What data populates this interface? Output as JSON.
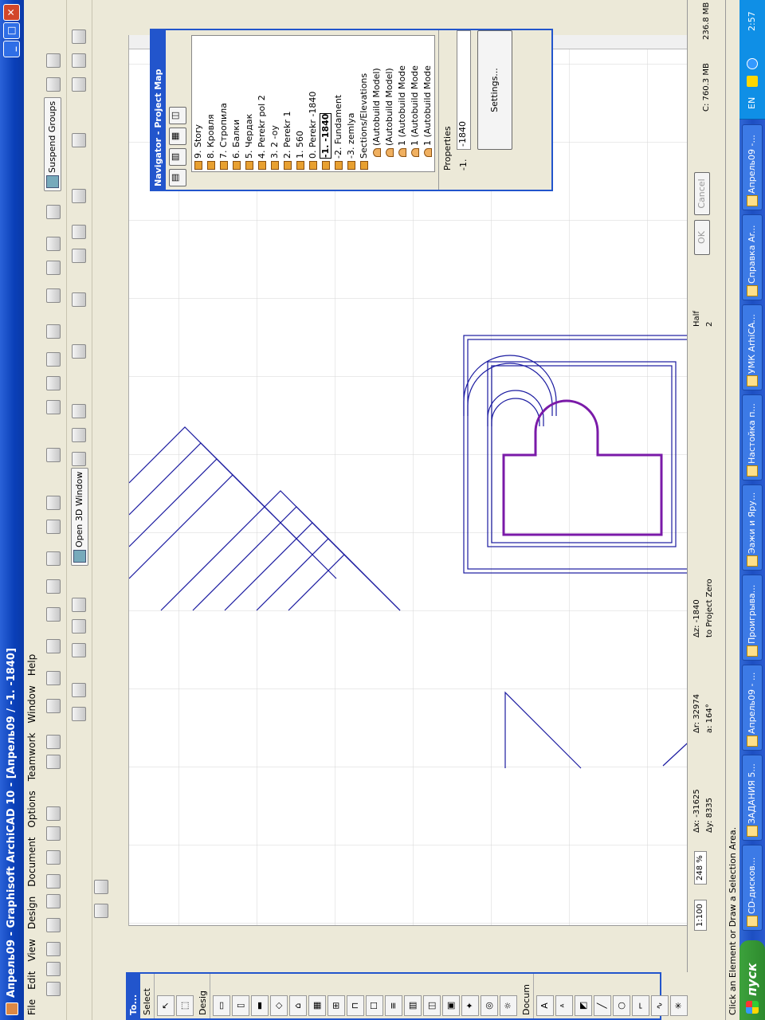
{
  "window": {
    "title": "Апрель09 - Graphisoft ArchiCAD 10 - [Апрель09 / -1. -1840]"
  },
  "menu": [
    "File",
    "Edit",
    "View",
    "Design",
    "Document",
    "Options",
    "Teamwork",
    "Window",
    "Help"
  ],
  "toolbar": {
    "suspend_groups": "Suspend Groups",
    "open_3d": "Open 3D Window"
  },
  "toolbox": {
    "title": "To...",
    "select_label": "Select",
    "design_label": "Desig",
    "document_label": "Docum"
  },
  "navigator": {
    "title": "Navigator - Project Map",
    "items": [
      {
        "label": "9. Story",
        "kind": "story"
      },
      {
        "label": "8. Кровля",
        "kind": "story"
      },
      {
        "label": "7. Стропила",
        "kind": "story"
      },
      {
        "label": "6. Балки",
        "kind": "story"
      },
      {
        "label": "5. Чердак",
        "kind": "story"
      },
      {
        "label": "4. Perekr pol 2",
        "kind": "story"
      },
      {
        "label": "3. 2 -oy",
        "kind": "story"
      },
      {
        "label": "2. Perekr 1",
        "kind": "story"
      },
      {
        "label": "1. 560",
        "kind": "story"
      },
      {
        "label": "0. Perekr -1840",
        "kind": "story"
      },
      {
        "label": "-1. -1840",
        "kind": "story",
        "selected": true
      },
      {
        "label": "-2. Fundament",
        "kind": "story"
      },
      {
        "label": "-3. zemlya",
        "kind": "story"
      },
      {
        "label": "Sections/Elevations",
        "kind": "group"
      },
      {
        "label": "(Autobuild Model)",
        "kind": "section"
      },
      {
        "label": "(Autobuild Model)",
        "kind": "section"
      },
      {
        "label": "1 (Autobuild Mode",
        "kind": "section"
      },
      {
        "label": "1 (Autobuild Mode",
        "kind": "section"
      },
      {
        "label": "1 (Autobuild Mode",
        "kind": "section"
      }
    ],
    "properties_label": "Properties",
    "prop_id": "-1.",
    "prop_value": "-1840",
    "settings_button": "Settings..."
  },
  "infobox": {
    "scale": "1:100",
    "zoom": "248 %",
    "dx": "Δx: -31625",
    "dy": "Δy: 8335",
    "dr": "Δr: 32974",
    "angle": "a: 164°",
    "dz": "Δz: -1840",
    "to_project_zero": "to Project Zero",
    "half": "Half",
    "half_num": "2",
    "ok": "OK",
    "cancel": "Cancel",
    "disk_c": "C: 760.3 MB",
    "mem": "236.8 MB"
  },
  "status": {
    "text": "Click an Element or Draw a Selection Area."
  },
  "taskbar": {
    "start": "пуск",
    "tasks": [
      "CD-дисков...",
      "ЗАДАНИЯ 5...",
      "Апрель09 - ...",
      "Проигрыва...",
      "Эажи и Яру...",
      "Настойка п...",
      "УМК АrhiCA...",
      "Справка Ar...",
      "Апрель09 -..."
    ],
    "lang": "EN",
    "clock": "2:57"
  },
  "colors": {
    "accent": "#2255cc",
    "drawing_line": "#1a1aa0",
    "selected_wall": "#7a1aa8",
    "grid": "#d8d8d8"
  }
}
